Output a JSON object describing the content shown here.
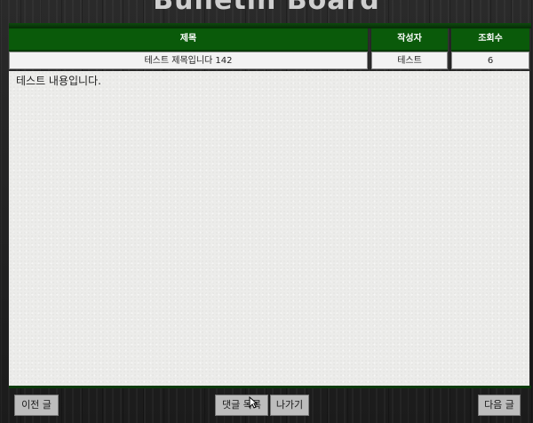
{
  "app": {
    "title": "Bulletin Board"
  },
  "table": {
    "headers": {
      "title": "제목",
      "author": "작성자",
      "views": "조회수"
    },
    "row": {
      "title": "테스트 제목입니다 142",
      "author": "테스트",
      "views": "6"
    }
  },
  "post": {
    "content": "테스트 내용입니다."
  },
  "buttons": {
    "prev": "이전 글",
    "comments": "댓글 목록",
    "exit": "나가기",
    "next": "다음 글"
  },
  "colors": {
    "header_green": "#0a5a0a",
    "paper": "#ececea",
    "frame": "#1e1e1e"
  }
}
